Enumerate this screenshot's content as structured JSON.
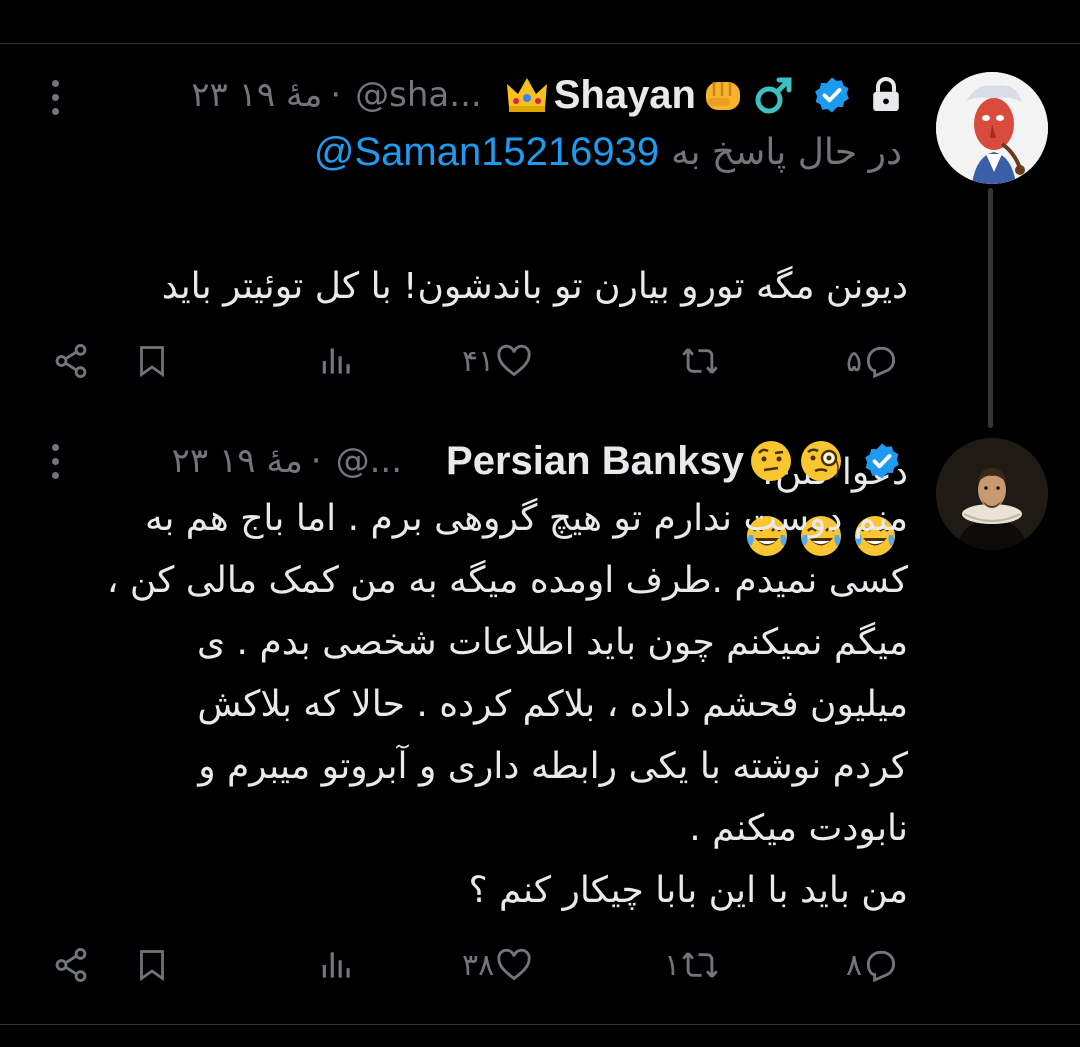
{
  "colors": {
    "background": "#000000",
    "text": "#e7e9ea",
    "muted": "#71767b",
    "accent": "#1d9bf0",
    "verified": "#1d9bf0"
  },
  "tweets": [
    {
      "display_name": "Shayan",
      "name_emojis_before": [
        "crown"
      ],
      "name_emojis_after": [
        "fist",
        "male-sign"
      ],
      "verified": true,
      "locked": true,
      "handle": "@sha...",
      "separator": "·",
      "date": "۲۳ مهٔ ۱۹",
      "replying_to_label": "در حال پاسخ به",
      "replying_to_handle": "@Saman15216939",
      "text_line1": "دیونن مگه تورو بیارن تو باندشون! با کل توئیتر باید",
      "text_line2": "دعوا کنن!",
      "text_emojis": [
        "face-with-tears-of-joy",
        "face-with-tears-of-joy",
        "face-with-tears-of-joy"
      ],
      "replies": "۵",
      "retweets": "",
      "likes": "۴۱",
      "icons": {
        "reply": "reply-icon",
        "retweet": "retweet-icon",
        "like": "heart-icon",
        "views": "views-icon",
        "bookmark": "bookmark-icon",
        "share": "share-icon"
      }
    },
    {
      "display_name": "Persian Banksy",
      "name_emojis_after": [
        "face-with-raised-eyebrow",
        "face-with-monocle"
      ],
      "verified": true,
      "locked": false,
      "handle": "@...",
      "separator": "·",
      "date": "۲۳ مهٔ ۱۹",
      "text": "منم دوست ندارم تو هیچ گروهی برم . اما باج هم به\nکسی نمیدم .طرف اومده میگه به من کمک مالی کن ،\nمیگم نمیکنم چون باید اطلاعات شخصی بدم . ی\nمیلیون فحشم داده ، بلاکم کرده . حالا که بلاکش\nکردم نوشته با یکی رابطه داری و آبروتو میبرم و\nنابودت میکنم .\nمن باید با این بابا چیکار کنم ؟",
      "replies": "۸",
      "retweets": "۱",
      "likes": "۳۸",
      "icons": {
        "reply": "reply-icon",
        "retweet": "retweet-icon",
        "like": "heart-icon",
        "views": "views-icon",
        "bookmark": "bookmark-icon",
        "share": "share-icon"
      }
    }
  ]
}
